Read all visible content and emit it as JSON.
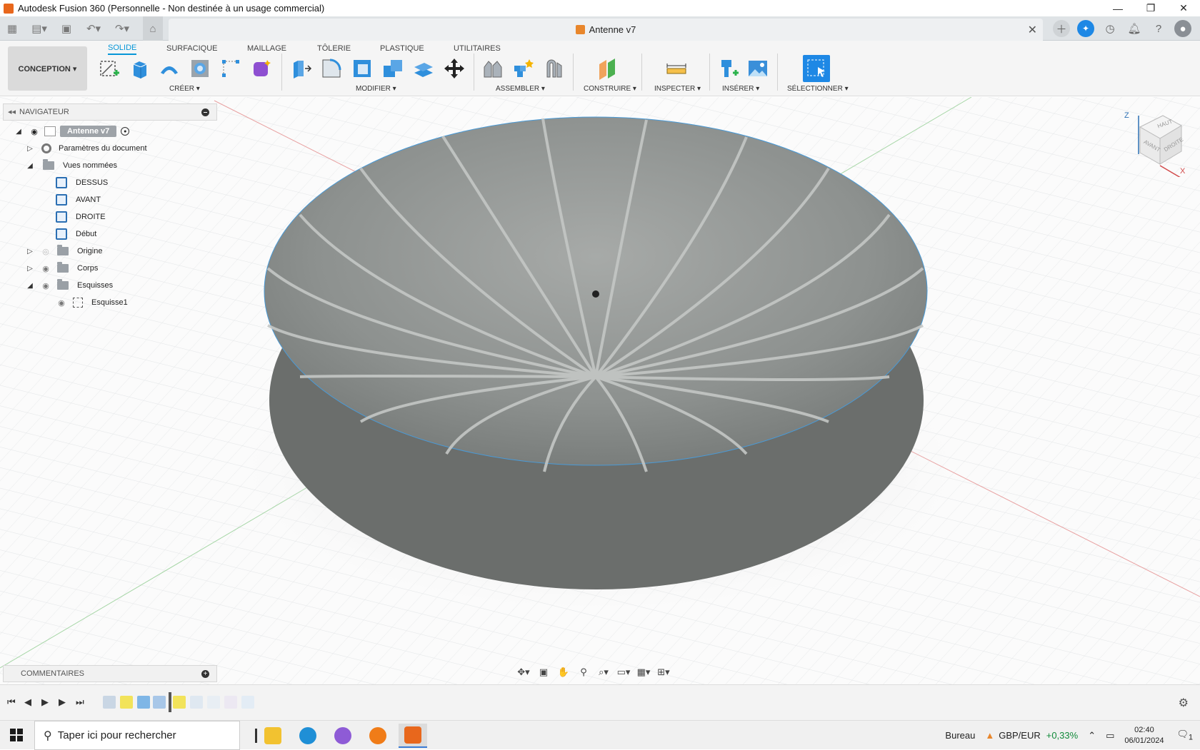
{
  "window": {
    "title": "Autodesk Fusion 360 (Personnelle - Non destinée à un usage commercial)",
    "controls": [
      "minimize-icon",
      "restore-icon",
      "close-icon"
    ]
  },
  "document": {
    "title": "Antenne v7"
  },
  "workspace": {
    "label": "CONCEPTION ▾"
  },
  "tabs": [
    {
      "label": "SOLIDE",
      "active": true
    },
    {
      "label": "SURFACIQUE"
    },
    {
      "label": "MAILLAGE"
    },
    {
      "label": "TÔLERIE"
    },
    {
      "label": "PLASTIQUE"
    },
    {
      "label": "UTILITAIRES"
    }
  ],
  "groups": {
    "creer": "CRÉER ▾",
    "modifier": "MODIFIER ▾",
    "assembler": "ASSEMBLER ▾",
    "construire": "CONSTRUIRE ▾",
    "inspecter": "INSPECTER ▾",
    "inserer": "INSÉRER ▾",
    "selectionner": "SÉLECTIONNER ▾"
  },
  "navigator": {
    "title": "NAVIGATEUR",
    "root": "Antenne v7",
    "items": [
      {
        "label": "Paramètres du document"
      },
      {
        "label": "Vues nommées"
      },
      {
        "label": "DESSUS"
      },
      {
        "label": "AVANT"
      },
      {
        "label": "DROITE"
      },
      {
        "label": "Début"
      },
      {
        "label": "Origine"
      },
      {
        "label": "Corps"
      },
      {
        "label": "Esquisses"
      },
      {
        "label": "Esquisse1"
      }
    ]
  },
  "viewcube": {
    "top": "HAUT",
    "front": "AVANT",
    "right": "DROITE",
    "axis_z": "Z",
    "axis_x": "X"
  },
  "comments": {
    "label": "COMMENTAIRES"
  },
  "taskbar": {
    "search_placeholder": "Taper ici pour rechercher",
    "desktop_label": "Bureau",
    "fx_pair": "GBP/EUR",
    "fx_change": "+0,33%",
    "time": "02:40",
    "date": "06/01/2024",
    "notifications": "1"
  },
  "colors": {
    "accent": "#0696d7",
    "select_blue": "#1e88e5",
    "dish_gray": "#8d918f"
  }
}
